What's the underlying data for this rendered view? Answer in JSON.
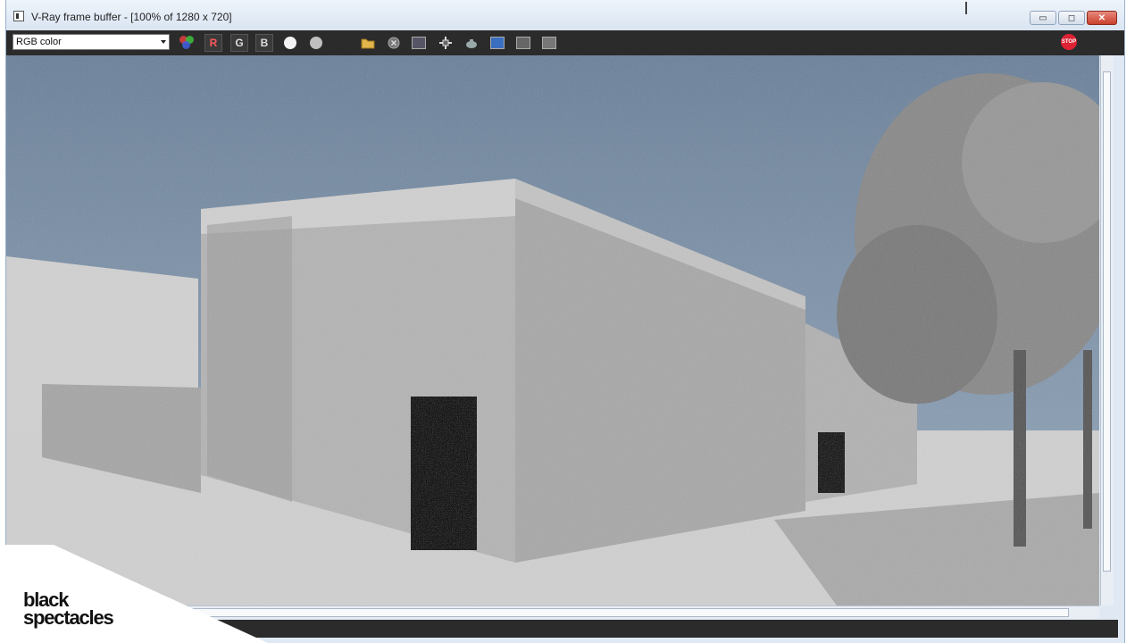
{
  "window": {
    "title": "V-Ray frame buffer - [100% of 1280 x 720]",
    "minimize_label": "",
    "maximize_label": "",
    "close_label": "✕"
  },
  "toolbar": {
    "channel_value": "RGB color",
    "r_label": "R",
    "g_label": "G",
    "b_label": "B",
    "stop_label": "STOP"
  },
  "icons": [
    "rgb-color-icon",
    "white-dot-icon",
    "grey-dot-icon",
    "open-folder-icon",
    "clear-icon",
    "region-icon",
    "track-mouse-icon",
    "render-teapot-icon",
    "compare-ab-icon",
    "lut-icon",
    "pixel-info-icon",
    "stop-icon"
  ],
  "watermark": {
    "line1": "black",
    "line2": "spectacles"
  },
  "colors": {
    "toolbar_bg": "#2b2b2b",
    "sky": "#7f95ad",
    "stop": "#dd2233"
  }
}
